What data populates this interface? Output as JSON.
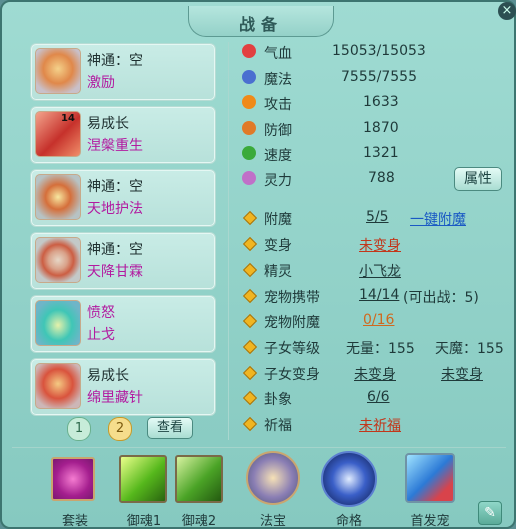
{
  "window": {
    "title": "战备",
    "close": "×"
  },
  "skills": [
    {
      "line1": "神通：空",
      "line2": "激励",
      "badge": ""
    },
    {
      "line1": "易成长",
      "line2": "涅槃重生",
      "badge": "14"
    },
    {
      "line1": "神通：空",
      "line2": "天地护法",
      "badge": ""
    },
    {
      "line1": "神通：空",
      "line2": "天降甘霖",
      "badge": ""
    },
    {
      "line1": "愤怒",
      "line2": "止戈",
      "badge": ""
    },
    {
      "line1": "易成长",
      "line2": "绵里藏针",
      "badge": ""
    }
  ],
  "pagination": {
    "page1": "1",
    "page2": "2",
    "view_button": "查看"
  },
  "stats": [
    {
      "icon": "heart-icon",
      "name": "气血",
      "value": "15053/15053",
      "color": "#e24040"
    },
    {
      "icon": "mana-icon",
      "name": "魔法",
      "value": "7555/7555",
      "color": "#4a6fd0"
    },
    {
      "icon": "attack-icon",
      "name": "攻击",
      "value": "1633",
      "color": "#f08a18"
    },
    {
      "icon": "shield-icon",
      "name": "防御",
      "value": "1870",
      "color": "#e07a28"
    },
    {
      "icon": "speed-icon",
      "name": "速度",
      "value": "1321",
      "color": "#3aaa3a"
    },
    {
      "icon": "spirit-icon",
      "name": "灵力",
      "value": "788",
      "color": "#c070c8"
    }
  ],
  "attributes_button": "属性",
  "items": [
    {
      "name": "附魔",
      "value1": "5/5",
      "value2": "一键附魔"
    },
    {
      "name": "变身",
      "value1": "未变身",
      "value2": ""
    },
    {
      "name": "精灵",
      "value1": "小飞龙",
      "value2": ""
    },
    {
      "name": "宠物携带",
      "value1": "14/14",
      "value2": "(可出战：5)"
    },
    {
      "name": "宠物附魔",
      "value1": "0/16",
      "value2": ""
    },
    {
      "name": "子女等级",
      "value1": "无量：155",
      "value2": "天魔：155"
    },
    {
      "name": "子女变身",
      "value1": "未变身",
      "value2": "未变身"
    },
    {
      "name": "卦象",
      "value1": "6/6",
      "value2": ""
    },
    {
      "name": "祈福",
      "value1": "未祈福",
      "value2": ""
    }
  ],
  "bottom_bar": [
    {
      "label": "套装",
      "icon": "heart-frame-icon"
    },
    {
      "label": "御魂1",
      "icon": "runner-icon"
    },
    {
      "label": "御魂2",
      "icon": "bird-icon"
    },
    {
      "label": "法宝",
      "icon": "treasure-ring-icon"
    },
    {
      "label": "命格",
      "icon": "fate-ghost-icon"
    },
    {
      "label": "首发宠",
      "icon": "pet-head-icon"
    }
  ],
  "colors": {
    "accent_purple": "#b21aa0",
    "link_blue": "#1a59c4",
    "warn_red": "#c2361a"
  }
}
